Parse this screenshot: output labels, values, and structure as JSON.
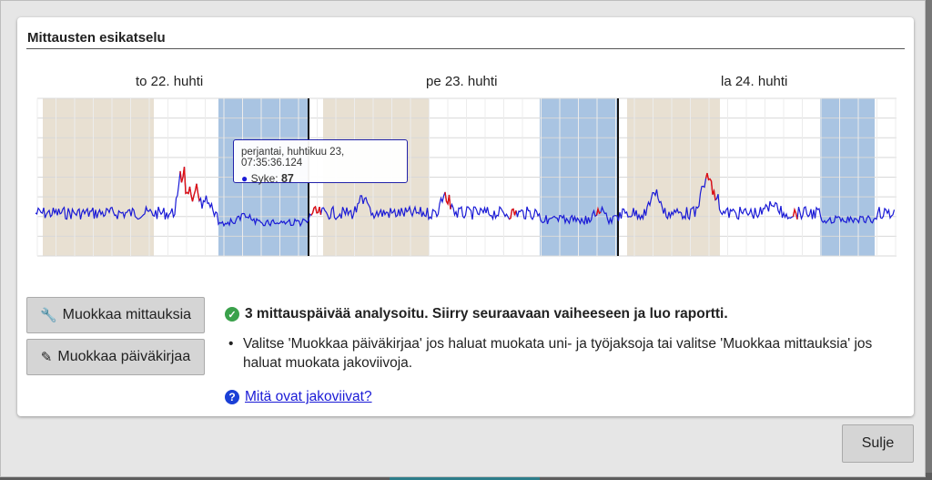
{
  "panel": {
    "title": "Mittausten esikatselu"
  },
  "chart": {
    "day_labels": [
      "to 22. huhti",
      "pe 23. huhti",
      "la 24. huhti"
    ],
    "tooltip": {
      "timestamp": "perjantai, huhtikuu 23, 07:35:36.124",
      "series_label": "Syke:",
      "value": "87"
    },
    "colors": {
      "line": "#1a1ad6",
      "highlight_line": "#e01010",
      "work_period": "#e8e0d2",
      "sleep_period": "#a9c4e2",
      "gridline": "#d8d8d8"
    }
  },
  "chart_data": {
    "type": "line",
    "series": [
      {
        "name": "Syke",
        "values": []
      }
    ],
    "tooltip_point": {
      "x": "perjantai, huhtikuu 23, 07:35:36.124",
      "y": 87
    },
    "grid": true
  },
  "actions": {
    "edit_measurements": "Muokkaa mittauksia",
    "edit_diary": "Muokkaa päiväkirjaa",
    "edit_measurements_icon": "wrench-icon",
    "edit_diary_icon": "pencil-icon"
  },
  "status": {
    "message": "3 mittauspäivää analysoitu. Siirry seuraavaan vaiheeseen ja luo raportti.",
    "icon": "check-circle-icon"
  },
  "info": {
    "bullet": "Valitse 'Muokkaa päiväkirjaa' jos haluat muokata uni- ja työjaksoja tai valitse 'Muokkaa mittauksia' jos haluat muokata jakoviivoja."
  },
  "help": {
    "link": "Mitä ovat jakoviivat?",
    "icon": "question-circle-icon"
  },
  "footer": {
    "close_label": "Sulje"
  }
}
